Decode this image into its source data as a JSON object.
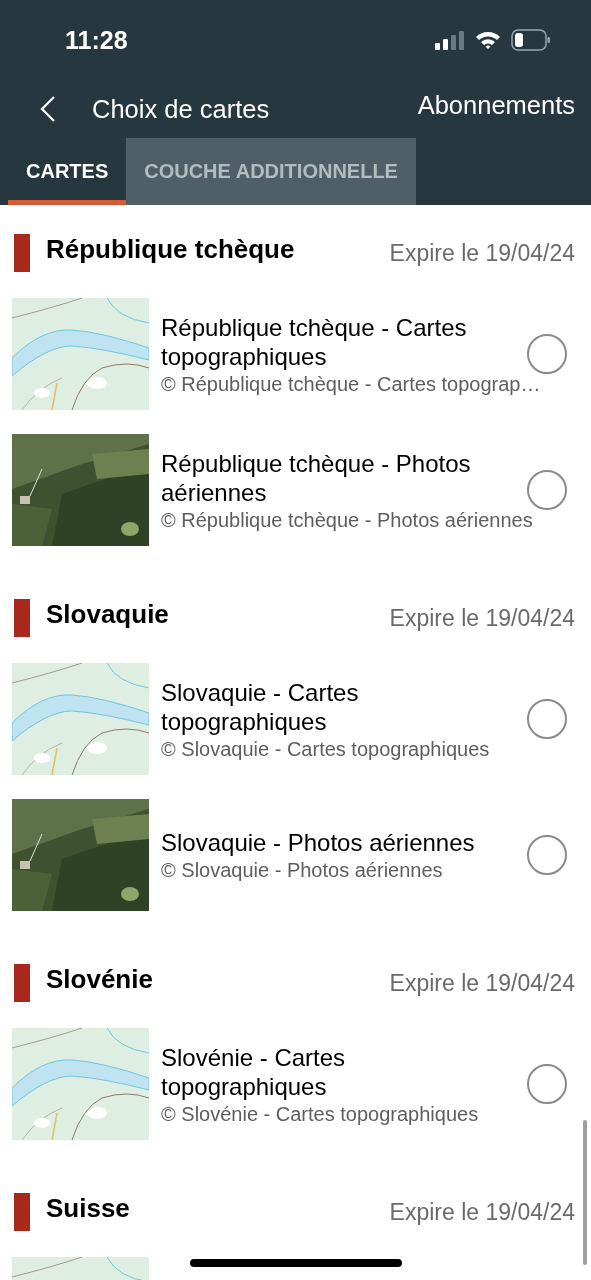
{
  "status_bar": {
    "time": "11:28"
  },
  "nav": {
    "title": "Choix de cartes",
    "action": "Abonnements"
  },
  "tabs": [
    {
      "label": "CARTES",
      "selected": true
    },
    {
      "label": "COUCHE ADDITIONNELLE",
      "selected": false
    }
  ],
  "sections": [
    {
      "title": "République tchèque",
      "expiry": "Expire le 19/04/24",
      "items": [
        {
          "title": "République tchèque - Cartes topographiques",
          "credit": "© République tchèque - Cartes topograp…",
          "selected": false
        },
        {
          "title": "République tchèque - Photos aériennes",
          "credit": "© République tchèque - Photos aériennes",
          "selected": false
        }
      ]
    },
    {
      "title": "Slovaquie",
      "expiry": "Expire le 19/04/24",
      "items": [
        {
          "title": "Slovaquie - Cartes topographiques",
          "credit": "© Slovaquie - Cartes topographiques",
          "selected": false
        },
        {
          "title": "Slovaquie - Photos aériennes",
          "credit": "© Slovaquie - Photos aériennes",
          "selected": false
        }
      ]
    },
    {
      "title": "Slovénie",
      "expiry": "Expire le 19/04/24",
      "items": [
        {
          "title": "Slovénie - Cartes topographiques",
          "credit": "© Slovénie - Cartes topographiques",
          "selected": false
        }
      ]
    },
    {
      "title": "Suisse",
      "expiry": "Expire le 19/04/24"
    }
  ]
}
